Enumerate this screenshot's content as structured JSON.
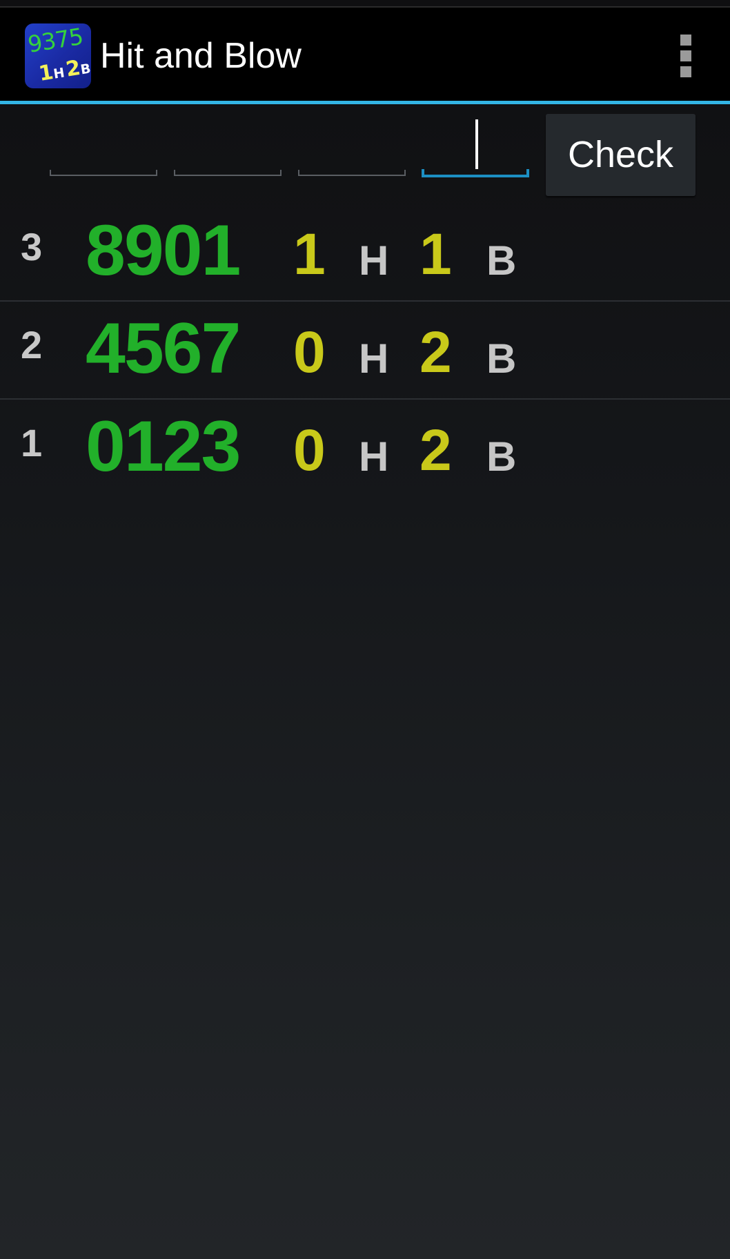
{
  "app": {
    "title": "Hit and Blow",
    "icon": {
      "name": "hit-and-blow-app-icon",
      "number": "9375",
      "hits": "1",
      "hit_letter": "H",
      "blows": "2",
      "blow_letter": "B"
    },
    "overflow_icon": "overflow-menu-icon"
  },
  "input": {
    "digits": [
      "",
      "",
      "",
      ""
    ],
    "focused_index": 3,
    "check_label": "Check"
  },
  "history": [
    {
      "index": "3",
      "guess": "8901",
      "hits": "1",
      "hit_label": "H",
      "blows": "1",
      "blow_label": "B"
    },
    {
      "index": "2",
      "guess": "4567",
      "hits": "0",
      "hit_label": "H",
      "blows": "2",
      "blow_label": "B"
    },
    {
      "index": "1",
      "guess": "0123",
      "hits": "0",
      "hit_label": "H",
      "blows": "2",
      "blow_label": "B"
    }
  ],
  "colors": {
    "accent": "#33b5e5",
    "guess": "#22b02a",
    "counts": "#c9c91a",
    "labels": "#c6c6c6"
  }
}
